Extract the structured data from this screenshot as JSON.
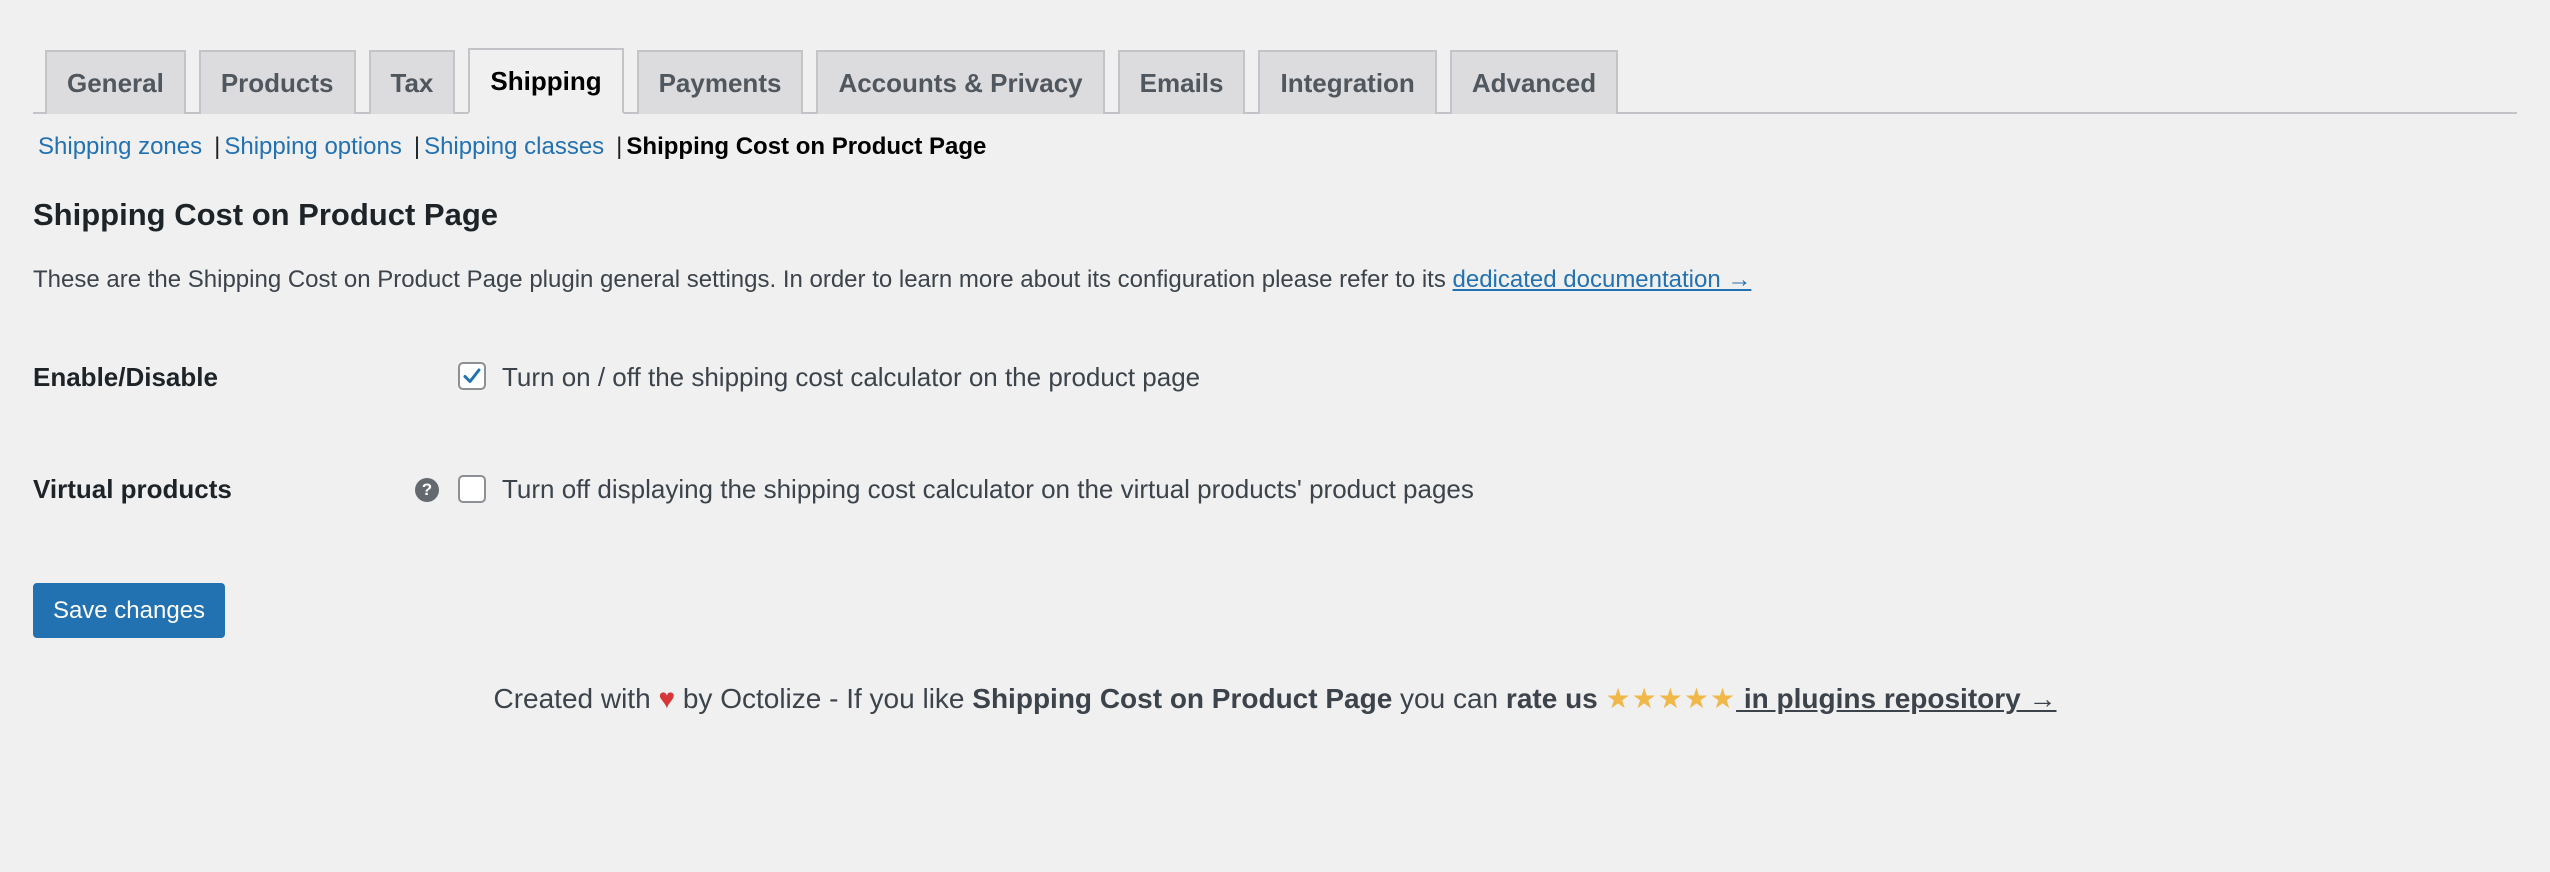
{
  "tabs": [
    {
      "label": "General",
      "active": false
    },
    {
      "label": "Products",
      "active": false
    },
    {
      "label": "Tax",
      "active": false
    },
    {
      "label": "Shipping",
      "active": true
    },
    {
      "label": "Payments",
      "active": false
    },
    {
      "label": "Accounts & Privacy",
      "active": false
    },
    {
      "label": "Emails",
      "active": false
    },
    {
      "label": "Integration",
      "active": false
    },
    {
      "label": "Advanced",
      "active": false
    }
  ],
  "subnav": {
    "items": [
      "Shipping zones",
      "Shipping options",
      "Shipping classes"
    ],
    "separator": "|",
    "current": "Shipping Cost on Product Page"
  },
  "page": {
    "title": "Shipping Cost on Product Page",
    "intro_text": "These are the Shipping Cost on Product Page plugin general settings. In order to learn more about its configuration please refer to its ",
    "intro_link": "dedicated documentation →"
  },
  "settings": {
    "enable": {
      "label": "Enable/Disable",
      "checked": true,
      "description": "Turn on / off the shipping cost calculator on the product page"
    },
    "virtual": {
      "label": "Virtual products",
      "help_icon": "?",
      "checked": false,
      "description": "Turn off displaying the shipping cost calculator on the virtual products' product pages"
    }
  },
  "save_button": "Save changes",
  "footer": {
    "created_with": "Created with",
    "heart": "♥",
    "by_text": " by Octolize - If you like ",
    "plugin_name": "Shipping Cost on Product Page",
    "you_can": " you can ",
    "rate_us": "rate us",
    "stars": "★★★★★",
    "repo_link": " in plugins repository →"
  },
  "colors": {
    "background": "#f0f0f1",
    "link": "#2271b1",
    "button": "#2271b1",
    "heart": "#d63638",
    "stars": "#f0b849"
  }
}
